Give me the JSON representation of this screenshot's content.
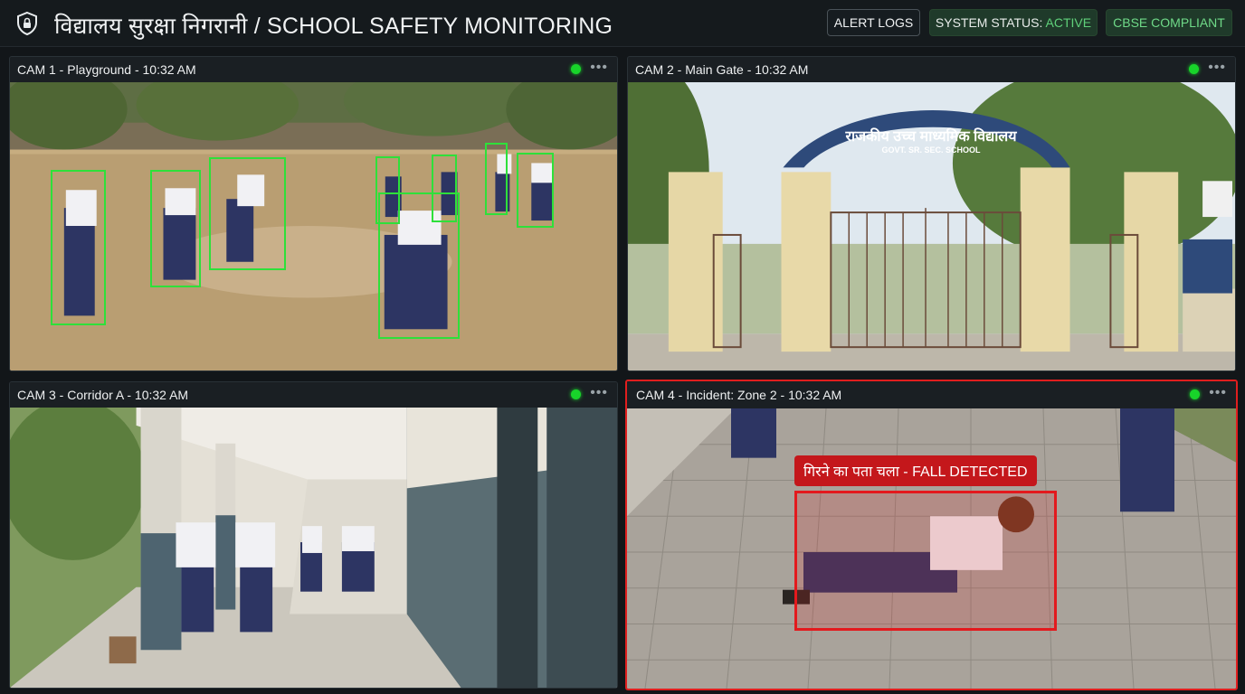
{
  "header": {
    "title": "विद्यालय सुरक्षा निगरानी / SCHOOL SAFETY MONITORING",
    "alert_logs_label": "ALERT LOGS",
    "status_prefix": "SYSTEM STATUS: ",
    "status_value": "ACTIVE",
    "compliance_label": "CBSE COMPLIANT",
    "logo_icon": "shield-lock-icon"
  },
  "cameras": [
    {
      "title": "CAM 1 - Playground - 10:32 AM",
      "status_color": "#18d42a"
    },
    {
      "title": "CAM 2 - Main Gate - 10:32 AM",
      "status_color": "#18d42a",
      "gate_sign_hindi": "राजकीय उच्च माध्यमिक विद्यालय",
      "gate_sign_english": "GOVT. SR. SEC. SCHOOL"
    },
    {
      "title": "CAM 3 - Corridor A - 10:32 AM",
      "status_color": "#18d42a"
    },
    {
      "title": "CAM 4 - Incident: Zone 2 - 10:32 AM",
      "status_color": "#18d42a",
      "alert_text": "गिरने का पता चला - FALL DETECTED",
      "alert_color": "#e01e1e"
    }
  ],
  "more_icon": "more-horizontal-icon"
}
